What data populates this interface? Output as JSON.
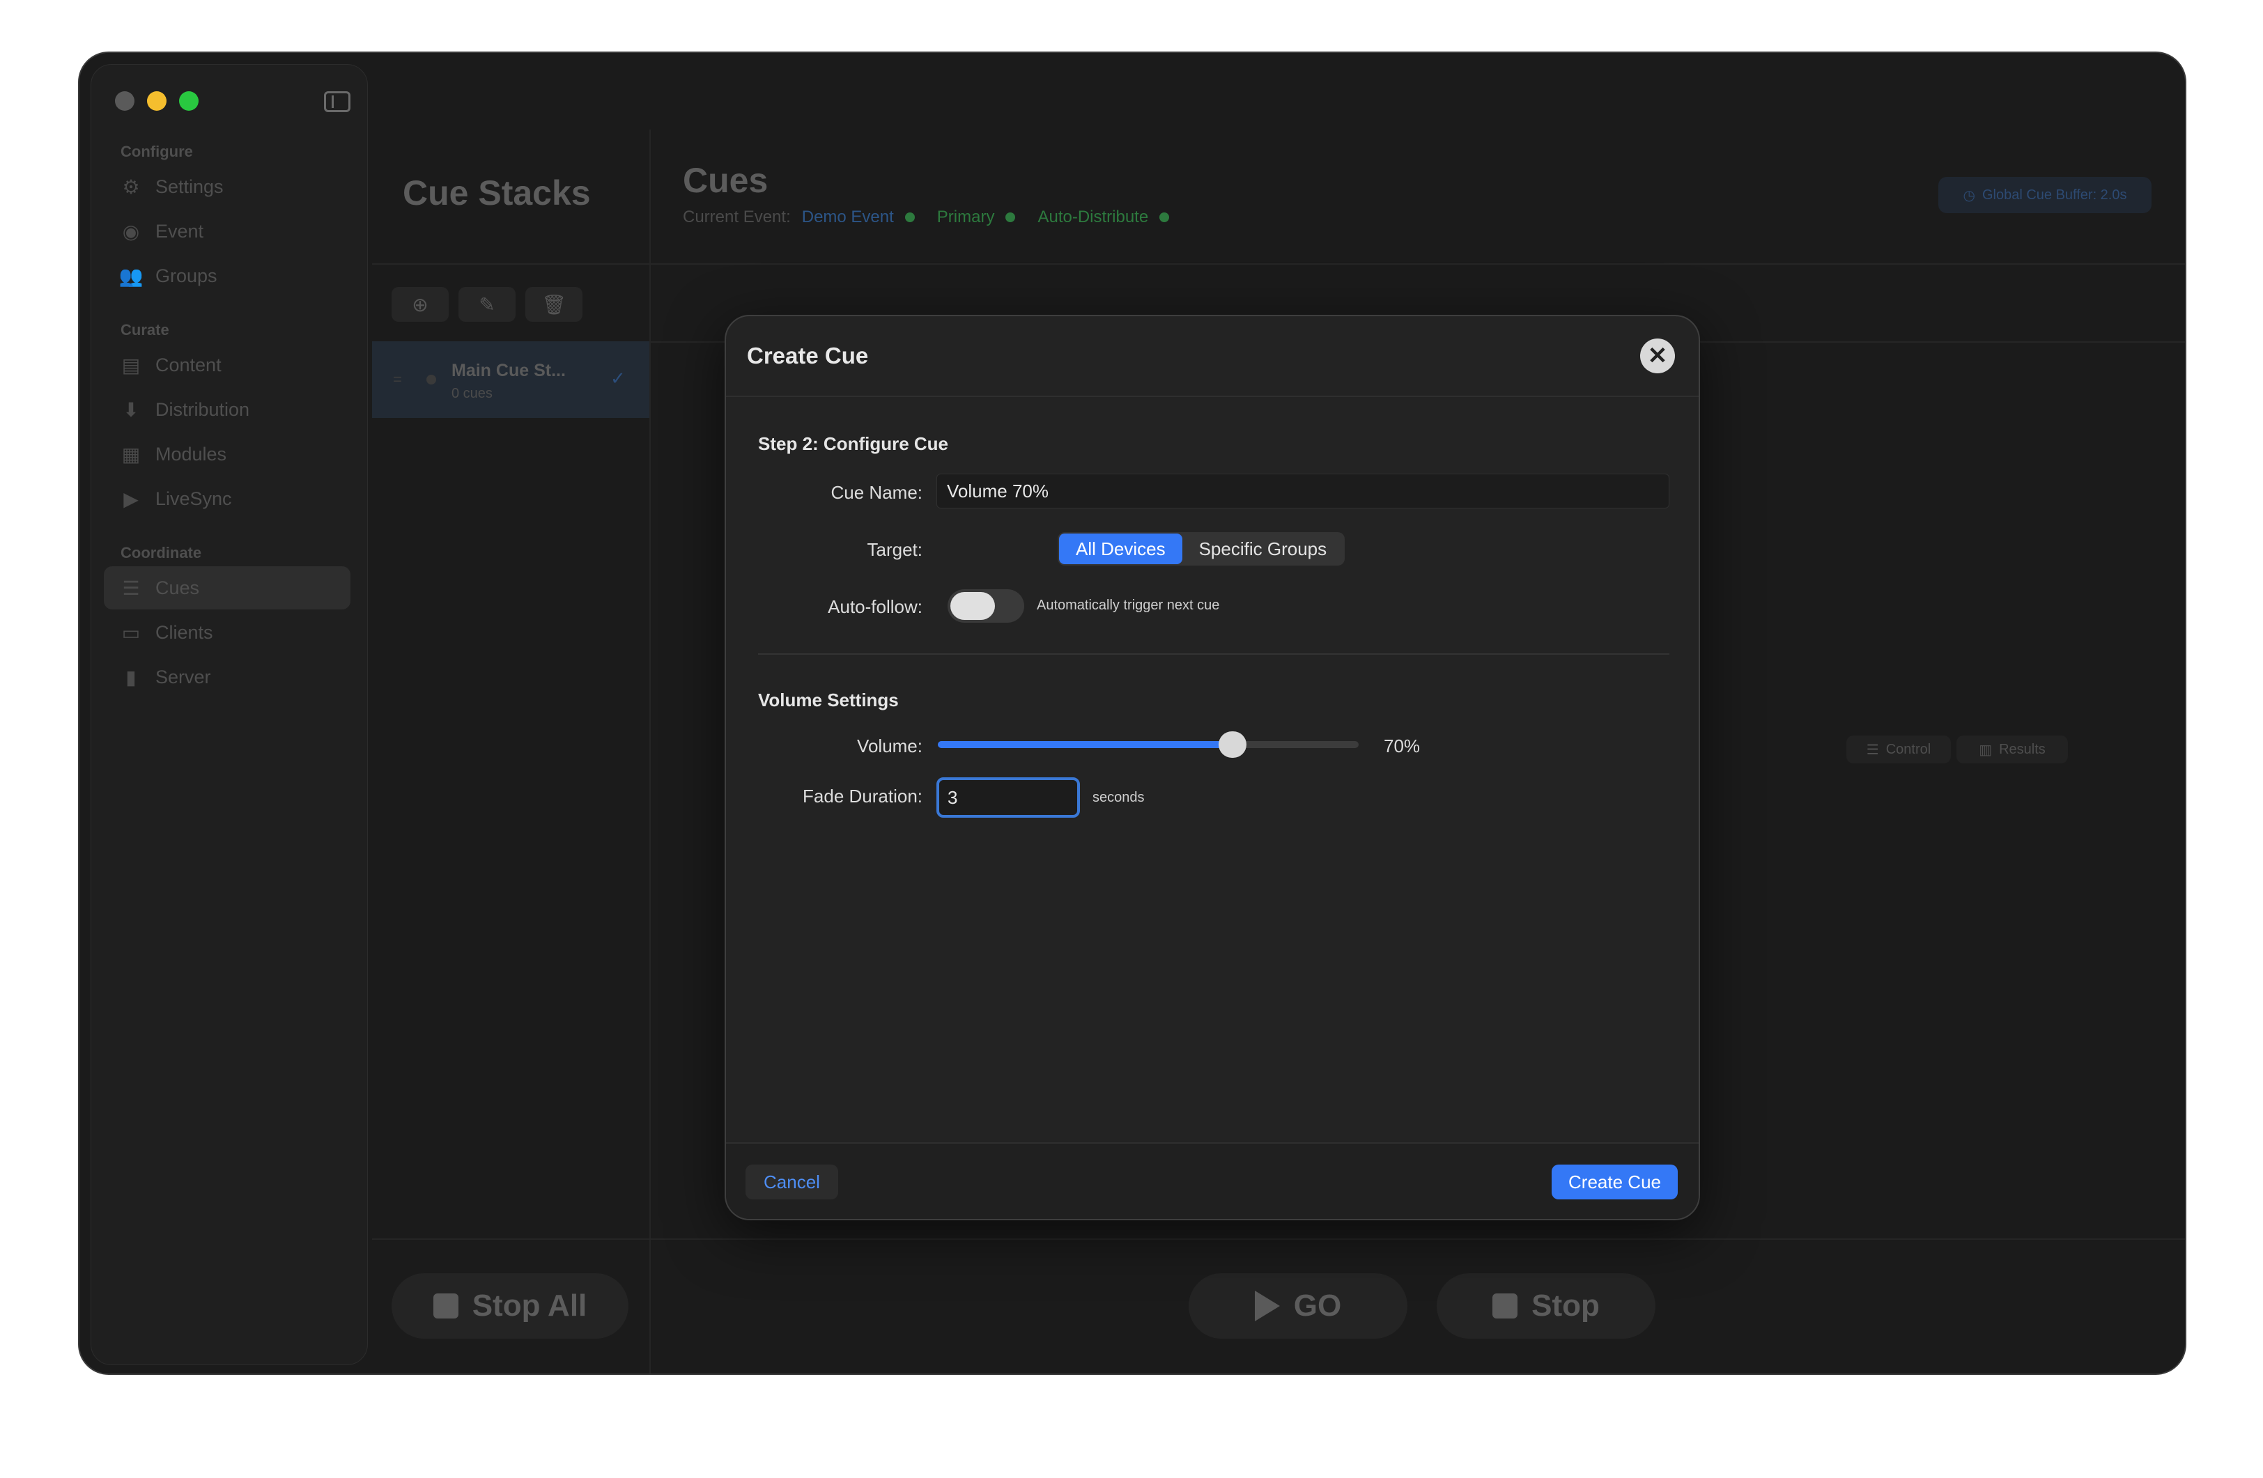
{
  "sidebar": {
    "sections": [
      {
        "title": "Configure",
        "items": [
          {
            "label": "Settings",
            "icon": "gear-icon"
          },
          {
            "label": "Event",
            "icon": "event-icon"
          },
          {
            "label": "Groups",
            "icon": "groups-icon"
          }
        ]
      },
      {
        "title": "Curate",
        "items": [
          {
            "label": "Content",
            "icon": "content-icon"
          },
          {
            "label": "Distribution",
            "icon": "distribution-icon"
          },
          {
            "label": "Modules",
            "icon": "modules-icon"
          },
          {
            "label": "LiveSync",
            "icon": "camera-icon"
          }
        ]
      },
      {
        "title": "Coordinate",
        "items": [
          {
            "label": "Cues",
            "icon": "cues-icon",
            "active": true
          },
          {
            "label": "Clients",
            "icon": "clients-icon"
          },
          {
            "label": "Server",
            "icon": "server-icon"
          }
        ]
      }
    ]
  },
  "stacks": {
    "title": "Cue Stacks",
    "items": [
      {
        "name": "Main Cue St...",
        "count": "0 cues"
      }
    ],
    "stop_all": "Stop All"
  },
  "cues": {
    "title": "Cues",
    "current_event_label": "Current Event:",
    "event_name": "Demo Event",
    "mode": "Primary",
    "distribution": "Auto-Distribute",
    "buffer": "Global Cue Buffer:  2.0s",
    "control_label": "Control",
    "results_label": "Results",
    "go_label": "GO",
    "stop_label": "Stop"
  },
  "modal": {
    "title": "Create Cue",
    "step_title": "Step 2: Configure Cue",
    "cue_name_label": "Cue Name:",
    "cue_name_value": "Volume 70%",
    "target_label": "Target:",
    "target_options": [
      "All Devices",
      "Specific Groups"
    ],
    "target_selected": "All Devices",
    "autofollow_label": "Auto-follow:",
    "autofollow_desc": "Automatically trigger next cue",
    "autofollow_on": false,
    "volume_section": "Volume Settings",
    "volume_label": "Volume:",
    "volume_fraction": 0.7,
    "volume_value": "70%",
    "fade_label": "Fade Duration:",
    "fade_value": "3",
    "fade_unit": "seconds",
    "cancel_label": "Cancel",
    "create_label": "Create Cue"
  },
  "colors": {
    "accent": "#3478f6",
    "status_green": "#2d7a3e"
  }
}
